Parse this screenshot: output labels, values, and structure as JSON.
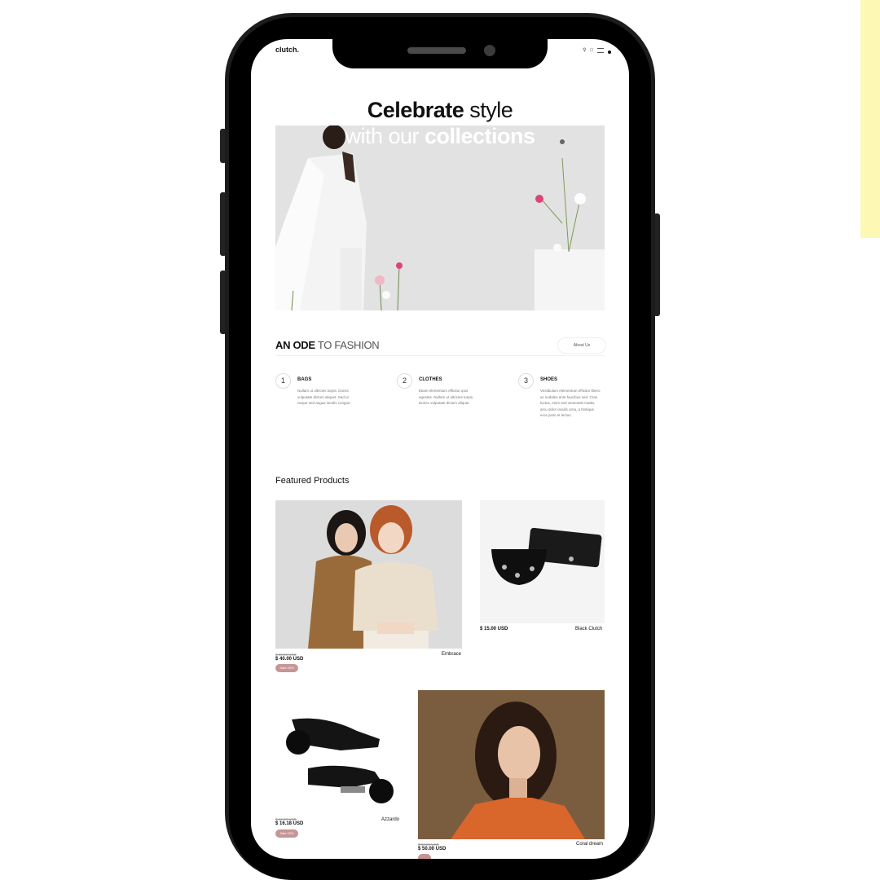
{
  "header": {
    "logo": "clutch."
  },
  "hero": {
    "title_bold": "Celebrate",
    "title_rest": " style",
    "line2_light": "with our ",
    "line2_bold": "collections"
  },
  "ode": {
    "bold": "AN ODE",
    "light": " TO FASHION",
    "about_label": "About Us"
  },
  "steps": [
    {
      "num": "1",
      "title": "BAGS",
      "desc": "Nullam ut ultricies turpis. Donec vulputate dictum aliquet. Sed ut neque sed augue iaculis congue."
    },
    {
      "num": "2",
      "title": "CLOTHES",
      "desc": "Etiam elementum efficitur quis egestas. Nullam ut ultricies turpis. Donec vulputate dictum aliquet."
    },
    {
      "num": "3",
      "title": "SHOES",
      "desc": "Vestibulum elementum efficitur libero ac sodales ante faucibus sed. Cras luctus, enim sed venenatis mattis, arcu dolor iaculis urna, a tristique eros justo et lectus."
    }
  ],
  "featured": {
    "heading": "Featured Products"
  },
  "products": [
    {
      "name": "Embrace",
      "price": "$ 40.00 USD",
      "old_price": "$ 50.00 USD",
      "badge": "Sale 20%"
    },
    {
      "name": "Black Clutch",
      "price": "$ 15.00 USD"
    },
    {
      "name": "Azzardo",
      "price": "$ 16.18 USD",
      "old_price": "$ 20.00 USD",
      "badge": "Sale 20%"
    },
    {
      "name": "Coral dream",
      "price": "$ 50.00 USD",
      "old_price": "$ 60.00 USD"
    }
  ],
  "colors": {
    "accent_badge": "#c79595",
    "frame": "#1c1c1c",
    "strip": "#fdf8b4"
  },
  "icons": [
    "search-icon",
    "bag-icon",
    "menu-icon"
  ]
}
